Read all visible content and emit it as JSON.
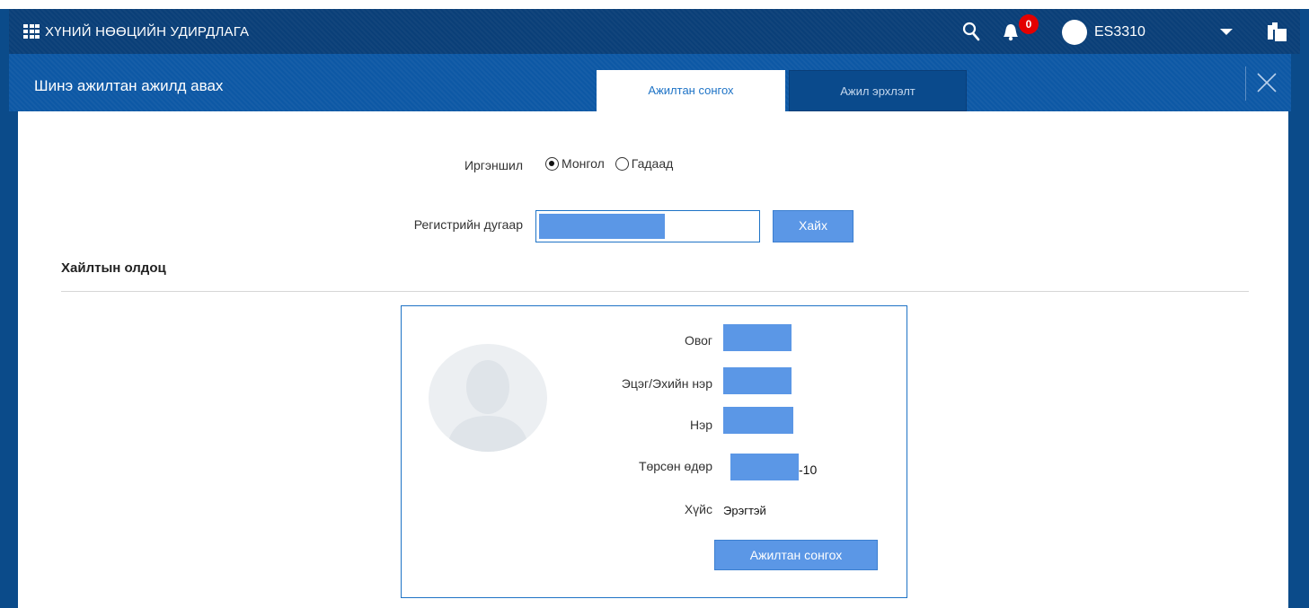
{
  "topbar": {
    "app_title": "ХҮНИЙ НӨӨЦИЙН УДИРДЛАГА",
    "notification_count": "0",
    "username": "ES3310",
    "icons": [
      "apps-grid-icon",
      "search-icon",
      "bell-icon",
      "user-avatar-icon",
      "caret-down-icon",
      "layers-icon"
    ]
  },
  "dialog": {
    "title": "Шинэ ажилтан ажилд авах",
    "tabs": [
      {
        "label": "Ажилтан сонгох",
        "active": true
      },
      {
        "label": "Ажил эрхлэлт",
        "active": false
      }
    ]
  },
  "form": {
    "citizenship_label": "Иргэншил",
    "citizenship_options": [
      {
        "label": "Монгол",
        "checked": true
      },
      {
        "label": "Гадаад",
        "checked": false
      }
    ],
    "reg_label": "Регистрийн дугаар",
    "search_button": "Хайх"
  },
  "results": {
    "section_title": "Хайлтын олдоц",
    "fields": {
      "last_name_label": "Овог",
      "patronymic_label": "Эцэг/Эхийн нэр",
      "first_name_label": "Нэр",
      "dob_label": "Төрсөн өдөр",
      "dob_suffix": "-10",
      "gender_label": "Хүйс",
      "gender_value": "Эрэгтэй"
    },
    "select_button": "Ажилтан сонгох"
  },
  "colors": {
    "topbar": "#0a3f78",
    "dialog_header": "#0d58a5",
    "accent": "#1e73c6",
    "button": "#5b97e6",
    "badge": "#e30000"
  }
}
